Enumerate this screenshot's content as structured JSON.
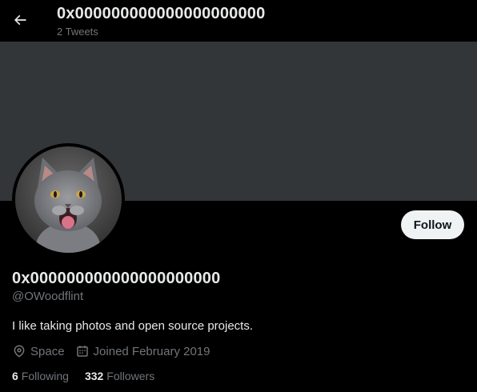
{
  "header": {
    "title": "0x000000000000000000000",
    "subtitle": "2 Tweets",
    "back_icon": "arrow-left-icon"
  },
  "profile": {
    "display_name": "0x000000000000000000000",
    "handle": "@OWoodflint",
    "bio": "I like taking photos and open source projects.",
    "location": "Space",
    "joined": "Joined February 2019",
    "following_count": "6",
    "following_label": "Following",
    "followers_count": "332",
    "followers_label": "Followers",
    "avatar_description": "gray kitten"
  },
  "actions": {
    "follow_label": "Follow"
  },
  "colors": {
    "background": "#000000",
    "banner": "#333639",
    "primary_text": "#e7e9ea",
    "secondary_text": "#71767b",
    "follow_button_bg": "#eff3f4"
  }
}
